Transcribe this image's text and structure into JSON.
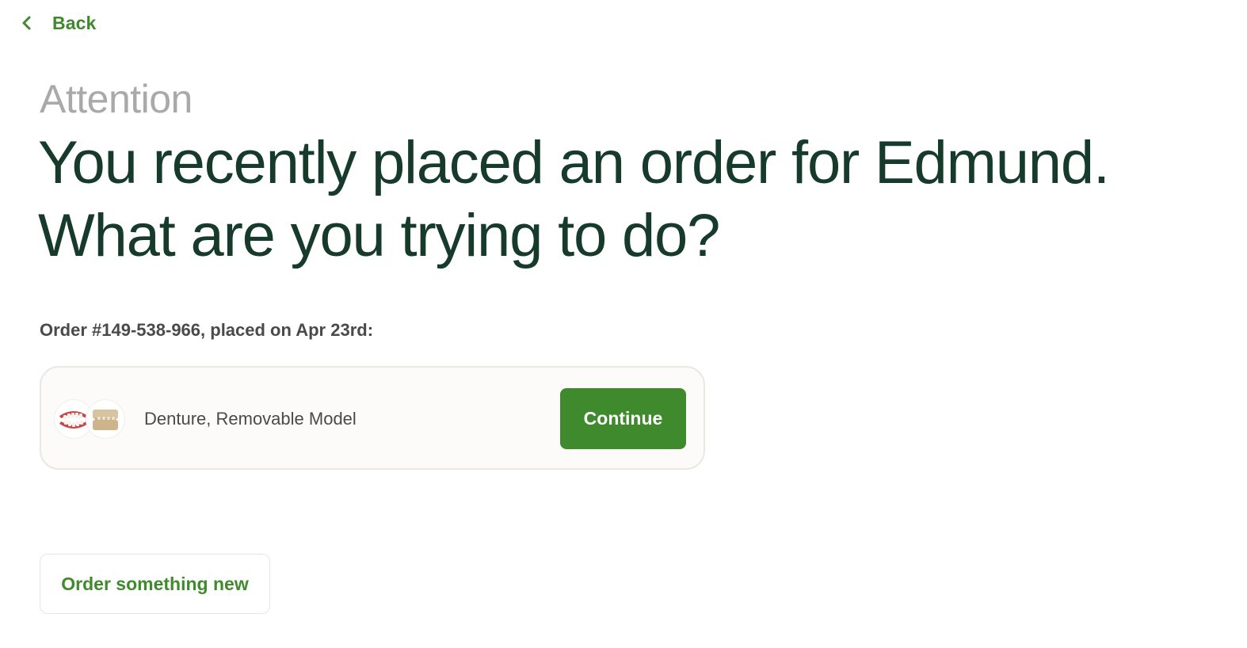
{
  "nav": {
    "back_label": "Back",
    "back_icon": "chevron-left-icon"
  },
  "header": {
    "eyebrow": "Attention",
    "headline_line1": "You recently placed an order for Edmund.",
    "headline_line2": "What are you trying to do?"
  },
  "order": {
    "meta": "Order #149-538-966, placed on Apr 23rd:",
    "item_label": "Denture, Removable Model",
    "thumbnails": [
      "denture-thumbnail",
      "model-thumbnail"
    ],
    "continue_label": "Continue"
  },
  "actions": {
    "new_order_label": "Order something new"
  },
  "colors": {
    "accent": "#3f8a2c",
    "headline": "#163a2b",
    "eyebrow": "#a9a9a9"
  }
}
